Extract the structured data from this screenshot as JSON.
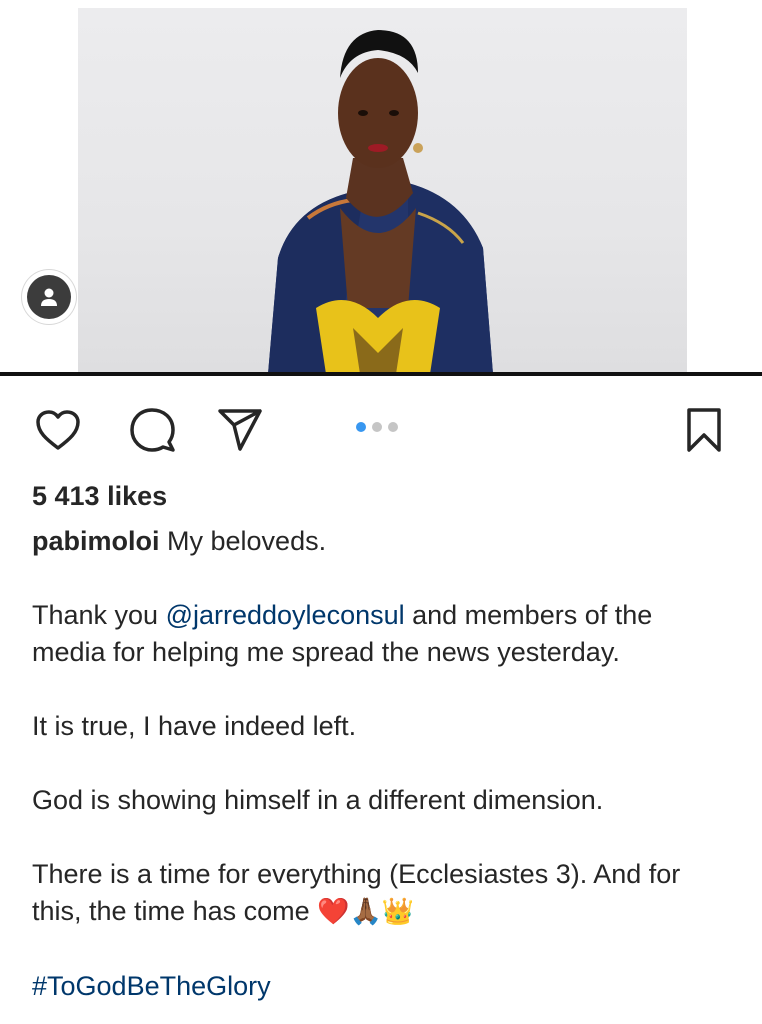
{
  "post": {
    "likes": "5 413 likes",
    "username": "pabimoloi",
    "caption_intro": "My beloveds.",
    "thank_prefix": "Thank you ",
    "mention": "@jarreddoyleconsul",
    "thank_suffix": " and members of the media for helping me spread the news yesterday.",
    "para2": "It is true, I have indeed left.",
    "para3": "God is showing himself in a different dimension.",
    "para4": "There is a time for everything (Ecclesiastes 3). And for this, the time has come ",
    "emoji_heart": "❤️",
    "emoji_pray": "🙏🏾",
    "emoji_crown": "👑",
    "hashtag": "#ToGodBeTheGlory"
  },
  "carousel": {
    "count": 3,
    "active": 1
  },
  "icons": {
    "like": "heart-icon",
    "comment": "comment-icon",
    "share": "send-icon",
    "save": "bookmark-icon",
    "profile": "person-icon"
  },
  "colors": {
    "accent": "#3897f0",
    "link": "#00376b",
    "text": "#262626"
  }
}
